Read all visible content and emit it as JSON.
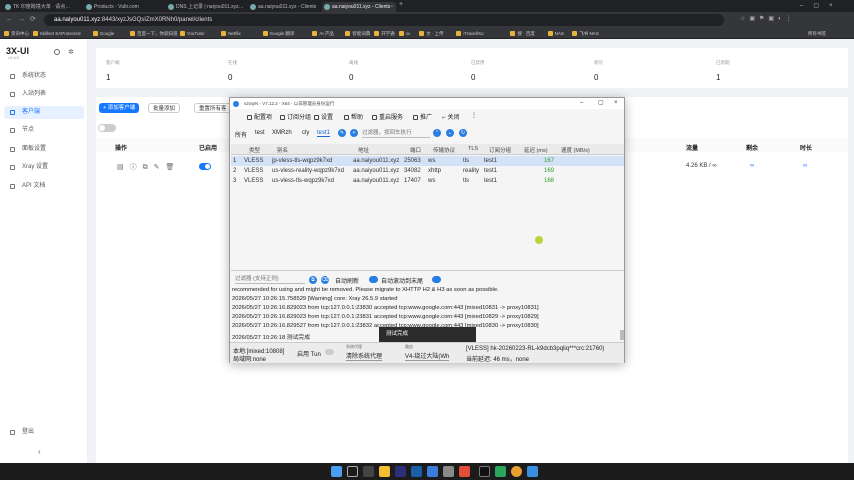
{
  "browser": {
    "tabs": [
      {
        "label": "TK 印度跨境大单 · 请点…"
      },
      {
        "label": "Products - Vultr.com"
      },
      {
        "label": "DNS 上记录 | naiyou011.xyz…"
      },
      {
        "label": "aa.naiyou011.xyz - Clients"
      },
      {
        "label": "aa.naiyou011.xyz - Clients"
      }
    ],
    "url_host": "aa.naiyou011.xyz",
    "url_rest": ":8443/xyzJsGQsIZmX0RNh0/panel/clients",
    "bookmarks": [
      "资讯中心",
      "Skillset SAProtected",
      "Google",
      "百度一下，你就知道",
      "YouTube",
      "Netflix",
      "Google 翻译",
      "AI 产品",
      "智能词典",
      "开学通",
      "xx",
      "文 · 上传",
      "iTravel/Xu",
      "搜 · 百度",
      "NAS",
      "飞书 NAS"
    ],
    "bookmarks_right": "所有书签"
  },
  "sidebar": {
    "logo": "3X-UI",
    "version": "v2.6.0",
    "items": [
      {
        "label": "系统状态",
        "icon": "dashboard-icon"
      },
      {
        "label": "入站列表",
        "icon": "list-icon"
      },
      {
        "label": "客户端",
        "icon": "user-icon"
      },
      {
        "label": "节点",
        "icon": "node-icon"
      },
      {
        "label": "面板设置",
        "icon": "settings-icon"
      },
      {
        "label": "Xray 设置",
        "icon": "tool-icon"
      },
      {
        "label": "API 文档",
        "icon": "code-icon"
      },
      {
        "label": "登出",
        "icon": "logout-icon"
      }
    ]
  },
  "stats": [
    {
      "label": "客户端",
      "value": "1"
    },
    {
      "label": "在线",
      "value": "0"
    },
    {
      "label": "离线",
      "value": "0"
    },
    {
      "label": "已禁用",
      "value": "0"
    },
    {
      "label": "耗尽",
      "value": "0"
    },
    {
      "label": "已到期",
      "value": "1"
    }
  ],
  "toolbar": {
    "add": "+ 添加客户端",
    "batch": "批量添加",
    "reset": "重置所有客"
  },
  "table": {
    "headers": [
      "操作",
      "已启用",
      "流量",
      "剩余",
      "时长"
    ],
    "row": {
      "traffic": "4.26 KB / ∞",
      "remaining": "∞",
      "duration": "∞"
    }
  },
  "v2rayn": {
    "title": "v2rayN - V7.12.2 - X64 - 以非管理员身份运行",
    "menu": [
      "配置项",
      "订阅分组",
      "设置",
      "帮助",
      "重启服务",
      "推广",
      "关闭"
    ],
    "filter_tabs": [
      "所有",
      "test",
      "XMRzh",
      "cly",
      "test1"
    ],
    "filter_placeholder": "过滤器，按回车执行",
    "headers": [
      "类型",
      "别名",
      "地址",
      "端口",
      "传输协议",
      "TLS",
      "订阅分组",
      "延迟 (ms)",
      "速度 (MB/s)"
    ],
    "rows": [
      {
        "n": "1",
        "type": "VLESS",
        "alias": "jp-vless-tls-wqpz9k7xd",
        "addr": "aa.naiyou011.xyz",
        "port": "25063",
        "net": "ws",
        "tls": "tls",
        "group": "test1",
        "lat": "167"
      },
      {
        "n": "2",
        "type": "VLESS",
        "alias": "us-vless-reality-wqpz9k7xd",
        "addr": "aa.naiyou011.xyz",
        "port": "34082",
        "net": "xhttp",
        "tls": "reality",
        "group": "test1",
        "lat": "169"
      },
      {
        "n": "3",
        "type": "VLESS",
        "alias": "us-vless-tls-wqpz9k7xd",
        "addr": "aa.naiyou011.xyz",
        "port": "17407",
        "net": "ws",
        "tls": "tls",
        "group": "test1",
        "lat": "168"
      }
    ],
    "log_filter_placeholder": "过滤器 (支持正则)",
    "auto_refresh": "自动刷新",
    "auto_scroll": "自动滚动到末尾",
    "log": [
      "recommended for using and might be removed. Please migrate to XHTTP H2 & H3 as soon as possible.",
      "2026/05/27 10:26:15.758529 [Warning] core: Xray 26.5.9 started",
      "2026/05/27 10:26:16.829023 from tcp:127.0.0.1:23830 accepted tcp:www.google.com:443 [mixed10831 -> proxy10831]",
      "2026/05/27 10:26:16.829023 from tcp:127.0.0.1:23831 accepted tcp:www.google.com:443 [mixed10829 -> proxy10829]",
      "2026/05/27 10:26:16.829527 from tcp:127.0.0.1:23832 accepted tcp:www.google.com:443 [mixed10830 -> proxy10830]",
      "2026/05/27 10:26:18 测试完成"
    ],
    "toast": "测试完成",
    "status": {
      "local": "本地:[mixed:10808]",
      "lan": "局域网:none",
      "tun": "启用 Tun",
      "sysproxy_label": "系统代理",
      "sysproxy": "清除系统代理",
      "route_label": "路由",
      "route": "V4-绕过大陆(Wh",
      "server": "[VLESS] hk-20260223-RL-k9dcb3pqliq***crc:21760)",
      "latency": "当前延迟: 46 ms，none"
    }
  },
  "colors": {
    "accent": "#1677ff",
    "v2_blue": "#2a7de1",
    "latency": "#2e9a2e"
  }
}
